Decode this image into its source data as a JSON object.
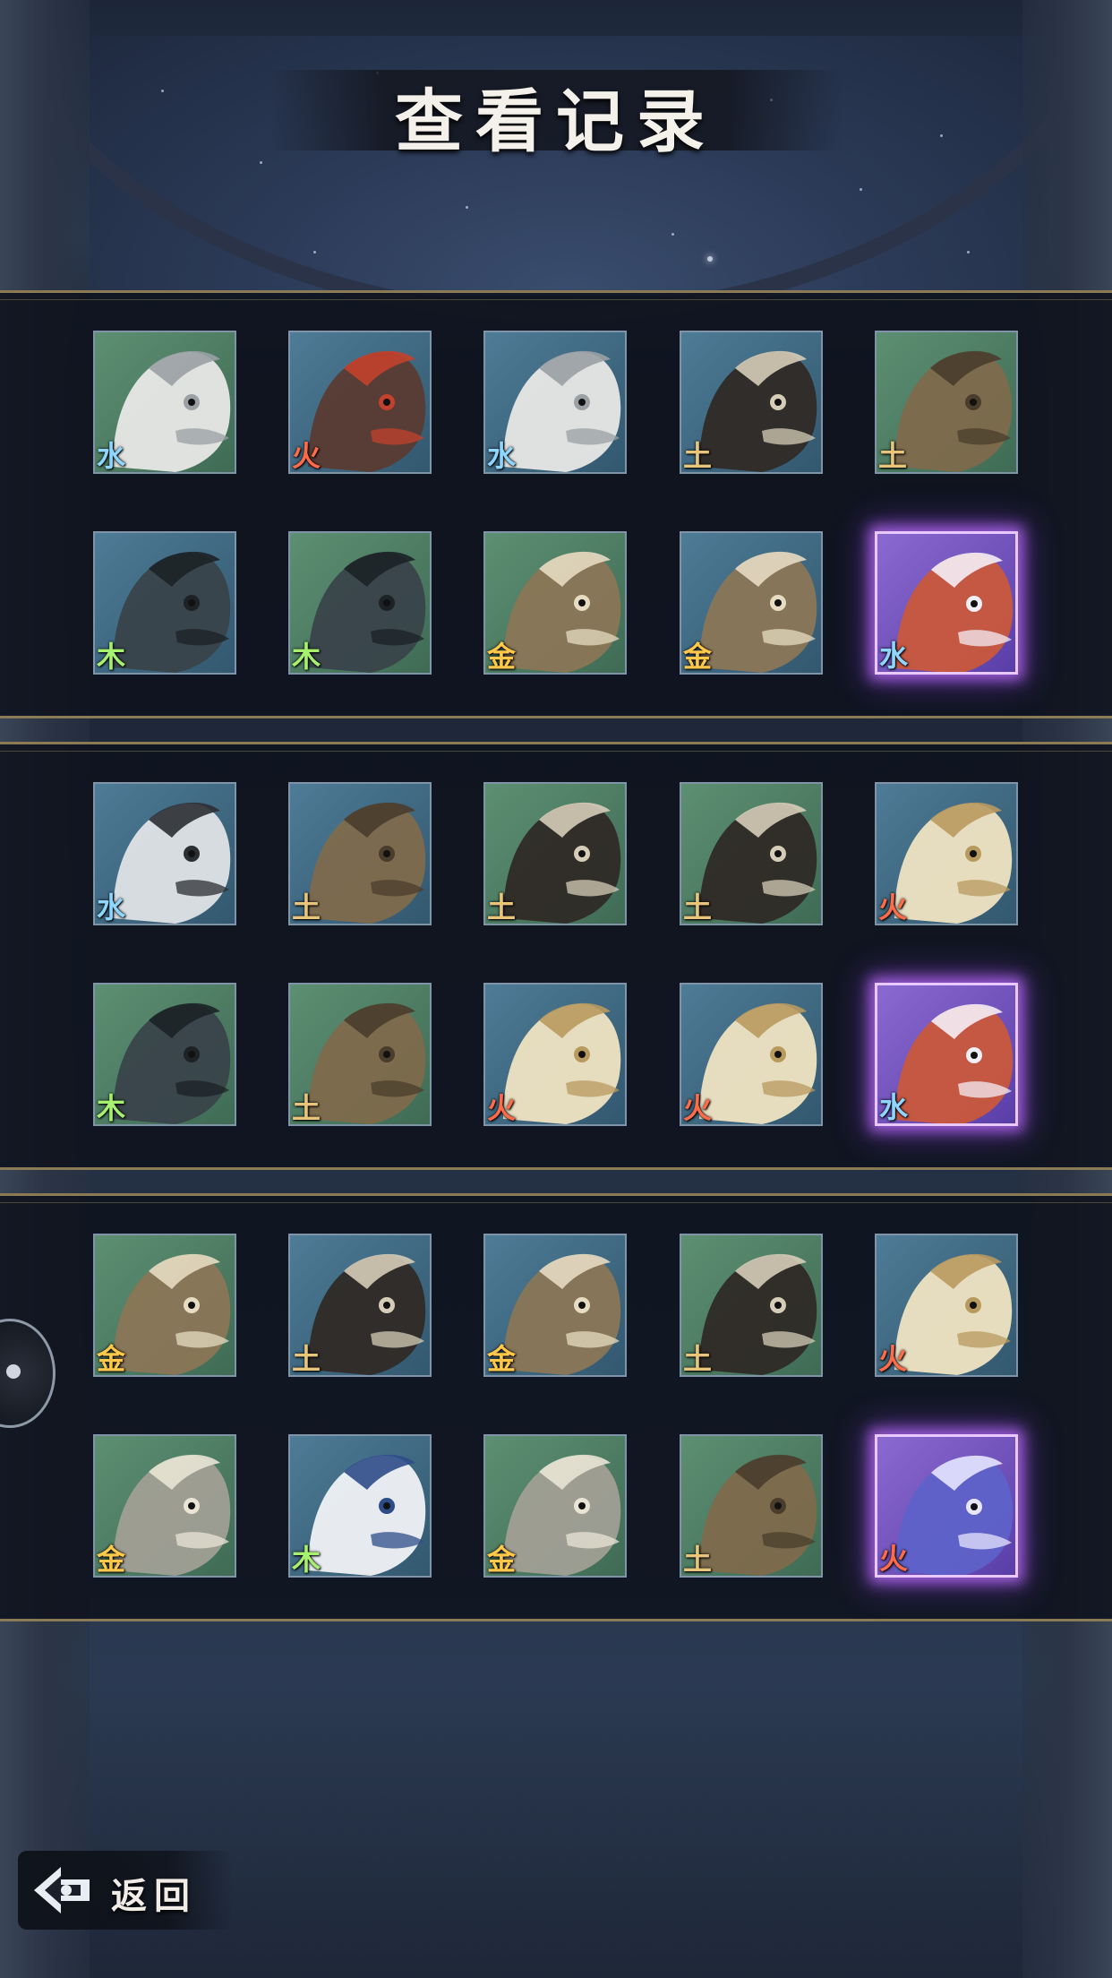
{
  "header": {
    "title": "查看记录"
  },
  "footer": {
    "back_label": "返回"
  },
  "element_colors": {
    "水": "#8fd6ff",
    "火": "#ff6a48",
    "土": "#e8c57a",
    "木": "#a8f070",
    "金": "#ffc84a"
  },
  "records": [
    {
      "rows": [
        [
          {
            "creature": "silver-fish-icon",
            "element": "水",
            "bg": "green",
            "rare": false
          },
          {
            "creature": "red-wolf-beast-icon",
            "element": "火",
            "bg": "blue",
            "rare": false
          },
          {
            "creature": "silver-fish-icon",
            "element": "水",
            "bg": "blue",
            "rare": false
          },
          {
            "creature": "horned-boar-icon",
            "element": "土",
            "bg": "blue",
            "rare": false
          },
          {
            "creature": "rock-beast-icon",
            "element": "土",
            "bg": "green",
            "rare": false
          }
        ],
        [
          {
            "creature": "dark-crab-beetle-icon",
            "element": "木",
            "bg": "blue",
            "rare": false
          },
          {
            "creature": "dark-crab-beetle-icon",
            "element": "木",
            "bg": "green",
            "rare": false
          },
          {
            "creature": "antlered-deer-beast-icon",
            "element": "金",
            "bg": "green",
            "rare": false
          },
          {
            "creature": "antlered-deer-beast-icon",
            "element": "金",
            "bg": "blue",
            "rare": false
          },
          {
            "creature": "red-fox-spirit-icon",
            "element": "水",
            "bg": "purple",
            "rare": true
          }
        ]
      ]
    },
    {
      "rows": [
        [
          {
            "creature": "white-crane-icon",
            "element": "水",
            "bg": "blue",
            "rare": false
          },
          {
            "creature": "rock-beast-icon",
            "element": "土",
            "bg": "blue",
            "rare": false
          },
          {
            "creature": "horned-boar-icon",
            "element": "土",
            "bg": "green",
            "rare": false
          },
          {
            "creature": "horned-boar-icon",
            "element": "土",
            "bg": "green",
            "rare": false
          },
          {
            "creature": "golden-crane-icon",
            "element": "火",
            "bg": "blue",
            "rare": false
          }
        ],
        [
          {
            "creature": "dark-crab-beetle-icon",
            "element": "木",
            "bg": "green",
            "rare": false
          },
          {
            "creature": "rock-beast-icon",
            "element": "土",
            "bg": "green",
            "rare": false
          },
          {
            "creature": "golden-crane-icon",
            "element": "火",
            "bg": "blue",
            "rare": false
          },
          {
            "creature": "golden-crane-icon",
            "element": "火",
            "bg": "blue",
            "rare": false
          },
          {
            "creature": "red-fox-spirit-icon",
            "element": "水",
            "bg": "purple",
            "rare": true
          }
        ]
      ]
    },
    {
      "rows": [
        [
          {
            "creature": "antlered-deer-beast-icon",
            "element": "金",
            "bg": "green",
            "rare": false
          },
          {
            "creature": "horned-boar-icon",
            "element": "土",
            "bg": "blue",
            "rare": false
          },
          {
            "creature": "antlered-deer-beast-icon",
            "element": "金",
            "bg": "blue",
            "rare": false
          },
          {
            "creature": "horned-boar-icon",
            "element": "土",
            "bg": "green",
            "rare": false
          },
          {
            "creature": "golden-crane-icon",
            "element": "火",
            "bg": "blue",
            "rare": false
          }
        ],
        [
          {
            "creature": "grey-dragon-icon",
            "element": "金",
            "bg": "green",
            "rare": false
          },
          {
            "creature": "white-tiger-icon",
            "element": "木",
            "bg": "blue",
            "rare": false
          },
          {
            "creature": "grey-dragon-icon",
            "element": "金",
            "bg": "green",
            "rare": false
          },
          {
            "creature": "rock-beast-icon",
            "element": "土",
            "bg": "green",
            "rare": false
          },
          {
            "creature": "blue-bird-spirit-icon",
            "element": "火",
            "bg": "purple",
            "rare": true
          }
        ]
      ]
    }
  ]
}
